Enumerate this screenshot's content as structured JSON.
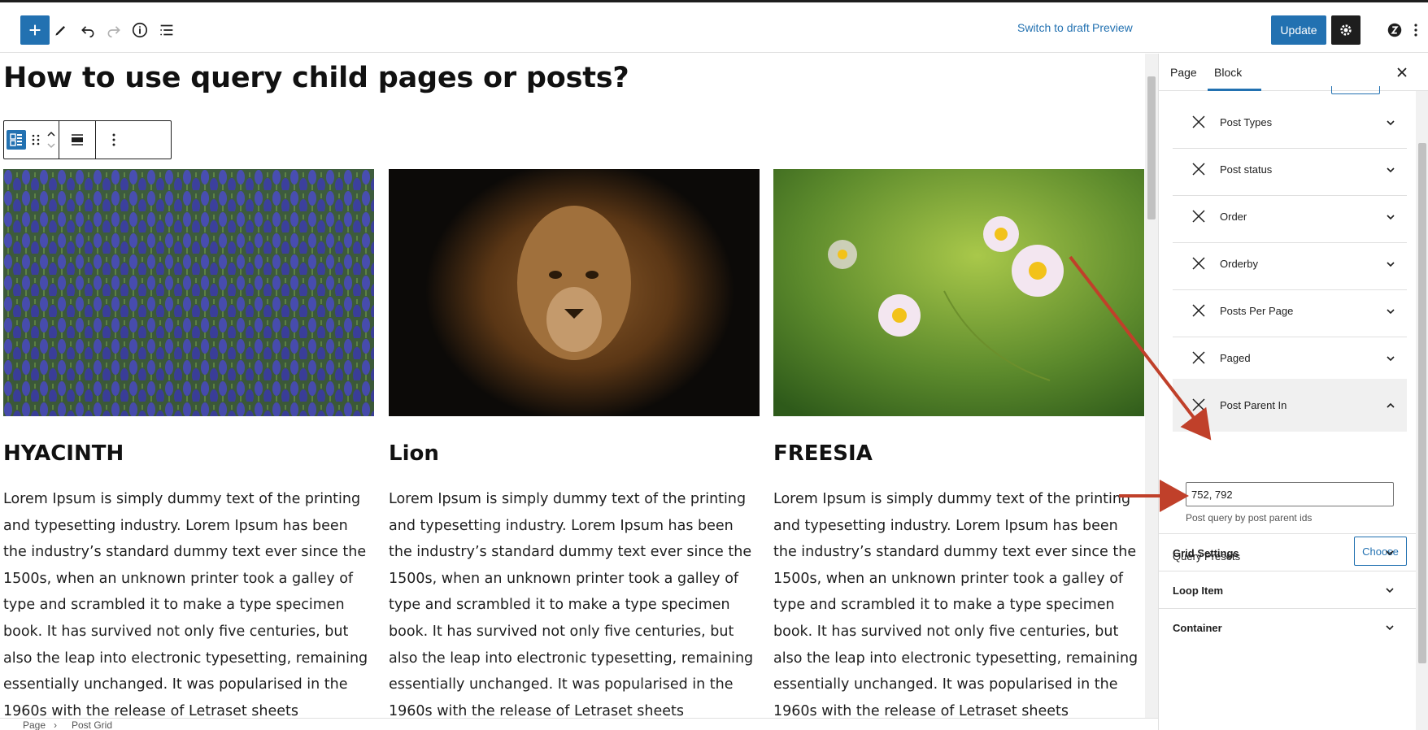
{
  "toolbar": {
    "switch_to_draft": "Switch to draft",
    "preview": "Preview",
    "update": "Update",
    "icons": [
      "plus-icon",
      "pencil-icon",
      "undo-icon",
      "redo-icon",
      "info-icon",
      "list-view-icon",
      "gear-icon",
      "brand-icon",
      "more-vertical-icon"
    ]
  },
  "editor": {
    "post_title": "How to use query child pages or posts?",
    "cards": [
      {
        "title": "HYACINTH",
        "image": "hyacinth-photo",
        "body": "Lorem Ipsum is simply dummy text of the printing and typesetting industry. Lorem Ipsum has been the industry’s standard dummy text ever since the 1500s, when an unknown printer took a galley of type and scrambled it to make a type specimen book. It has survived not only five centuries, but also the leap into electronic typesetting, remaining essentially unchanged. It was popularised in the 1960s with the release of Letraset sheets containing Lorem Ipsum passages, and"
      },
      {
        "title": "Lion",
        "image": "lion-photo",
        "body": "Lorem Ipsum is simply dummy text of the printing and typesetting industry. Lorem Ipsum has been the industry’s standard dummy text ever since the 1500s, when an unknown printer took a galley of type and scrambled it to make a type specimen book. It has survived not only five centuries, but also the leap into electronic typesetting, remaining essentially unchanged. It was popularised in the 1960s with the release of Letraset sheets containing Lorem Ipsum passages, and"
      },
      {
        "title": "FREESIA",
        "image": "freesia-photo",
        "body": "Lorem Ipsum is simply dummy text of the printing and typesetting industry. Lorem Ipsum has been the industry’s standard dummy text ever since the 1500s, when an unknown printer took a galley of type and scrambled it to make a type specimen book. It has survived not only five centuries, but also the leap into electronic typesetting, remaining essentially unchanged. It was popularised in the 1960s with the release of Letraset sheets containing Lorem Ipsum passages, and"
      }
    ]
  },
  "breadcrumb": {
    "items": [
      "Page",
      "Post Grid"
    ]
  },
  "sidebar": {
    "tabs": [
      "Page",
      "Block"
    ],
    "active_tab": "Block",
    "query_rows": [
      {
        "label": "Post Types",
        "expanded": false
      },
      {
        "label": "Post status",
        "expanded": false
      },
      {
        "label": "Order",
        "expanded": false
      },
      {
        "label": "Orderby",
        "expanded": false
      },
      {
        "label": "Posts Per Page",
        "expanded": false
      },
      {
        "label": "Paged",
        "expanded": false
      },
      {
        "label": "Post Parent In",
        "expanded": true
      }
    ],
    "post_parent_in": {
      "value": "752, 792",
      "help": "Post query by post parent ids"
    },
    "query_presets": {
      "label": "Query Presets",
      "button": "Choose"
    },
    "panels": [
      "Grid Settings",
      "Loop Item",
      "Container"
    ]
  },
  "colors": {
    "accent": "#2271b1",
    "annotation_arrow": "#c0402a"
  }
}
